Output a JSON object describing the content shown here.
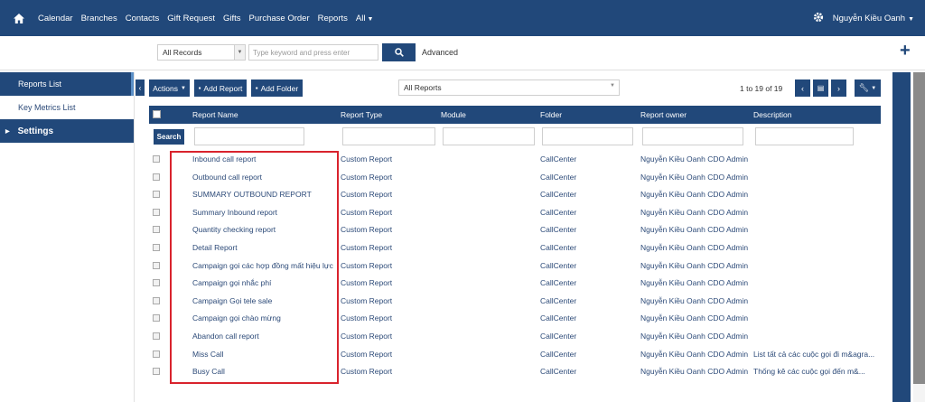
{
  "topnav": {
    "items": [
      "Calendar",
      "Branches",
      "Contacts",
      "Gift Request",
      "Gifts",
      "Purchase Order",
      "Reports",
      "All"
    ],
    "user": "Nguyễn Kiều Oanh"
  },
  "search": {
    "scope": "All Records",
    "placeholder": "Type keyword and press enter",
    "advanced": "Advanced"
  },
  "sidebar": {
    "items": [
      "Reports List",
      "Key Metrics List",
      "Settings"
    ]
  },
  "toolbar": {
    "actions": "Actions",
    "add_report": "Add Report",
    "add_folder": "Add Folder",
    "filter": "All Reports",
    "pager": "1 to 19 of 19"
  },
  "table": {
    "headers": [
      "Report Name",
      "Report Type",
      "Module",
      "Folder",
      "Report owner",
      "Description"
    ],
    "search_label": "Search",
    "rows": [
      {
        "name": "Inbound call report",
        "type": "Custom Report",
        "module": "",
        "folder": "CallCenter",
        "owner": "Nguyễn Kiều Oanh CDO Admin",
        "desc": ""
      },
      {
        "name": "Outbound call report",
        "type": "Custom Report",
        "module": "",
        "folder": "CallCenter",
        "owner": "Nguyễn Kiều Oanh CDO Admin",
        "desc": ""
      },
      {
        "name": "SUMMARY OUTBOUND REPORT",
        "type": "Custom Report",
        "module": "",
        "folder": "CallCenter",
        "owner": "Nguyễn Kiều Oanh CDO Admin",
        "desc": ""
      },
      {
        "name": "Summary Inbound report",
        "type": "Custom Report",
        "module": "",
        "folder": "CallCenter",
        "owner": "Nguyễn Kiều Oanh CDO Admin",
        "desc": ""
      },
      {
        "name": "Quantity checking report",
        "type": "Custom Report",
        "module": "",
        "folder": "CallCenter",
        "owner": "Nguyễn Kiều Oanh CDO Admin",
        "desc": ""
      },
      {
        "name": "Detail Report",
        "type": "Custom Report",
        "module": "",
        "folder": "CallCenter",
        "owner": "Nguyễn Kiều Oanh CDO Admin",
        "desc": ""
      },
      {
        "name": "Campaign gọi các hợp đồng mất hiệu lực",
        "type": "Custom Report",
        "module": "",
        "folder": "CallCenter",
        "owner": "Nguyễn Kiều Oanh CDO Admin",
        "desc": ""
      },
      {
        "name": "Campaign gọi nhắc phí",
        "type": "Custom Report",
        "module": "",
        "folder": "CallCenter",
        "owner": "Nguyễn Kiều Oanh CDO Admin",
        "desc": ""
      },
      {
        "name": "Campaign Gọi tele sale",
        "type": "Custom Report",
        "module": "",
        "folder": "CallCenter",
        "owner": "Nguyễn Kiều Oanh CDO Admin",
        "desc": ""
      },
      {
        "name": "Campaign gọi chào mừng",
        "type": "Custom Report",
        "module": "",
        "folder": "CallCenter",
        "owner": "Nguyễn Kiều Oanh CDO Admin",
        "desc": ""
      },
      {
        "name": "Abandon call report",
        "type": "Custom Report",
        "module": "",
        "folder": "CallCenter",
        "owner": "Nguyễn Kiều Oanh CDO Admin",
        "desc": ""
      },
      {
        "name": "Miss Call",
        "type": "Custom Report",
        "module": "",
        "folder": "CallCenter",
        "owner": "Nguyễn Kiều Oanh CDO Admin",
        "desc": "List tất cả các cuộc gọi đi m&agra..."
      },
      {
        "name": "Busy Call",
        "type": "Custom Report",
        "module": "",
        "folder": "CallCenter",
        "owner": "Nguyễn Kiều Oanh CDO Admin",
        "desc": "Thống kê các cuộc gọi đến m&..."
      }
    ]
  },
  "colors": {
    "primary": "#21487a",
    "highlight": "#d9232d"
  }
}
